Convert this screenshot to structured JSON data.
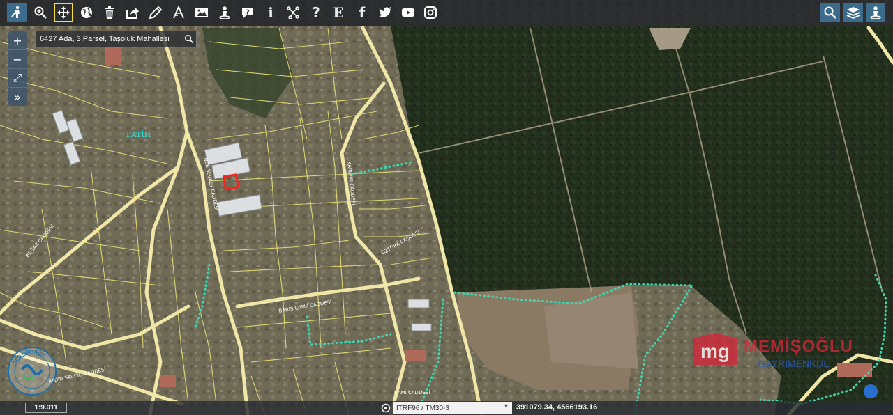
{
  "toolbar": {
    "left_tools": [
      {
        "name": "street-view-icon",
        "glyph": "person"
      },
      {
        "name": "zoom-in-tool-icon",
        "glyph": "magnify"
      },
      {
        "name": "pan-move-icon",
        "glyph": "move"
      },
      {
        "name": "globe-icon",
        "glyph": "globe"
      },
      {
        "name": "trash-icon",
        "glyph": "trash"
      },
      {
        "name": "share-icon",
        "glyph": "share"
      },
      {
        "name": "pencil-icon",
        "glyph": "pencil"
      },
      {
        "name": "measure-icon",
        "glyph": "measure"
      },
      {
        "name": "image-icon",
        "glyph": "image"
      },
      {
        "name": "pin-user-icon",
        "glyph": "pin"
      },
      {
        "name": "comment-question-icon",
        "glyph": "comment"
      },
      {
        "name": "info-icon",
        "glyph": "i"
      },
      {
        "name": "network-icon",
        "glyph": "network"
      },
      {
        "name": "help-icon",
        "glyph": "?"
      },
      {
        "name": "e-icon",
        "glyph": "E"
      },
      {
        "name": "facebook-icon",
        "glyph": "f"
      },
      {
        "name": "twitter-icon",
        "glyph": "bird"
      },
      {
        "name": "youtube-icon",
        "glyph": "play"
      },
      {
        "name": "instagram-icon",
        "glyph": "camera"
      }
    ],
    "right_tools": [
      {
        "name": "search-tool-icon",
        "glyph": "magnify"
      },
      {
        "name": "layers-icon",
        "glyph": "layers"
      },
      {
        "name": "location-user-icon",
        "glyph": "pin"
      }
    ]
  },
  "search": {
    "value": "6427 Ada, 3 Parsel, Taşoluk Mahallesi"
  },
  "zoom_controls": [
    {
      "name": "zoom-in-button",
      "glyph": "+"
    },
    {
      "name": "zoom-out-button",
      "glyph": "−"
    },
    {
      "name": "fullscreen-button",
      "glyph": "⤢"
    },
    {
      "name": "expand-panel-button",
      "glyph": "»"
    }
  ],
  "map": {
    "neighborhood_label": "FATİH",
    "road_labels": [
      "İNCE ŞEVKET CADDESİ",
      "KARDAN CADDESİ",
      "ÖZTÜRK CADDESİ",
      "BARIŞ CAMİİ CADDESİ",
      "BOĞAZ CADDESİ",
      "AYDIN SAVCILI CADDESİ",
      "CAMİ CADDESİ"
    ]
  },
  "status": {
    "scale": "1:9.011",
    "projection": "ITRF96 / TM30-3",
    "coordinates": "391079.34, 4566193.16"
  },
  "watermark": {
    "brand": "MEMİŞOĞLU",
    "subtitle": "GAYRİMENKUL",
    "mark": "mg"
  },
  "logo": {
    "text": "ARNAVUTKÖY"
  },
  "colors": {
    "toolbar_bg": "#1c2026",
    "active_outline": "#f5e04a",
    "parcel_lines": "#e8e27a",
    "selected_parcel": "#ff2020",
    "boundary_dots": "#3fd6b0",
    "watermark_red": "#d4273a",
    "watermark_blue": "#2a57a8"
  }
}
